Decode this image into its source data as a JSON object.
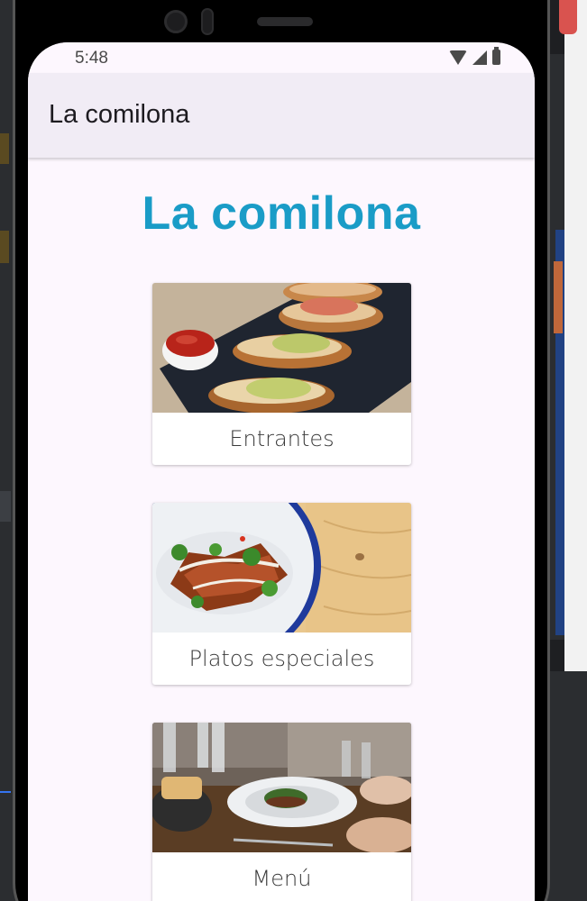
{
  "status_bar": {
    "time": "5:48",
    "icons": [
      "wifi-icon",
      "signal-icon",
      "battery-icon"
    ]
  },
  "app_bar": {
    "title": "La comilona"
  },
  "main": {
    "heading": "La comilona",
    "heading_color": "#1a9cc7",
    "cards": [
      {
        "label": "Entrantes",
        "image": "bruschetta-photo"
      },
      {
        "label": "Platos especiales",
        "image": "plated-dish-photo"
      },
      {
        "label": "Menú",
        "image": "restaurant-table-photo"
      }
    ]
  }
}
